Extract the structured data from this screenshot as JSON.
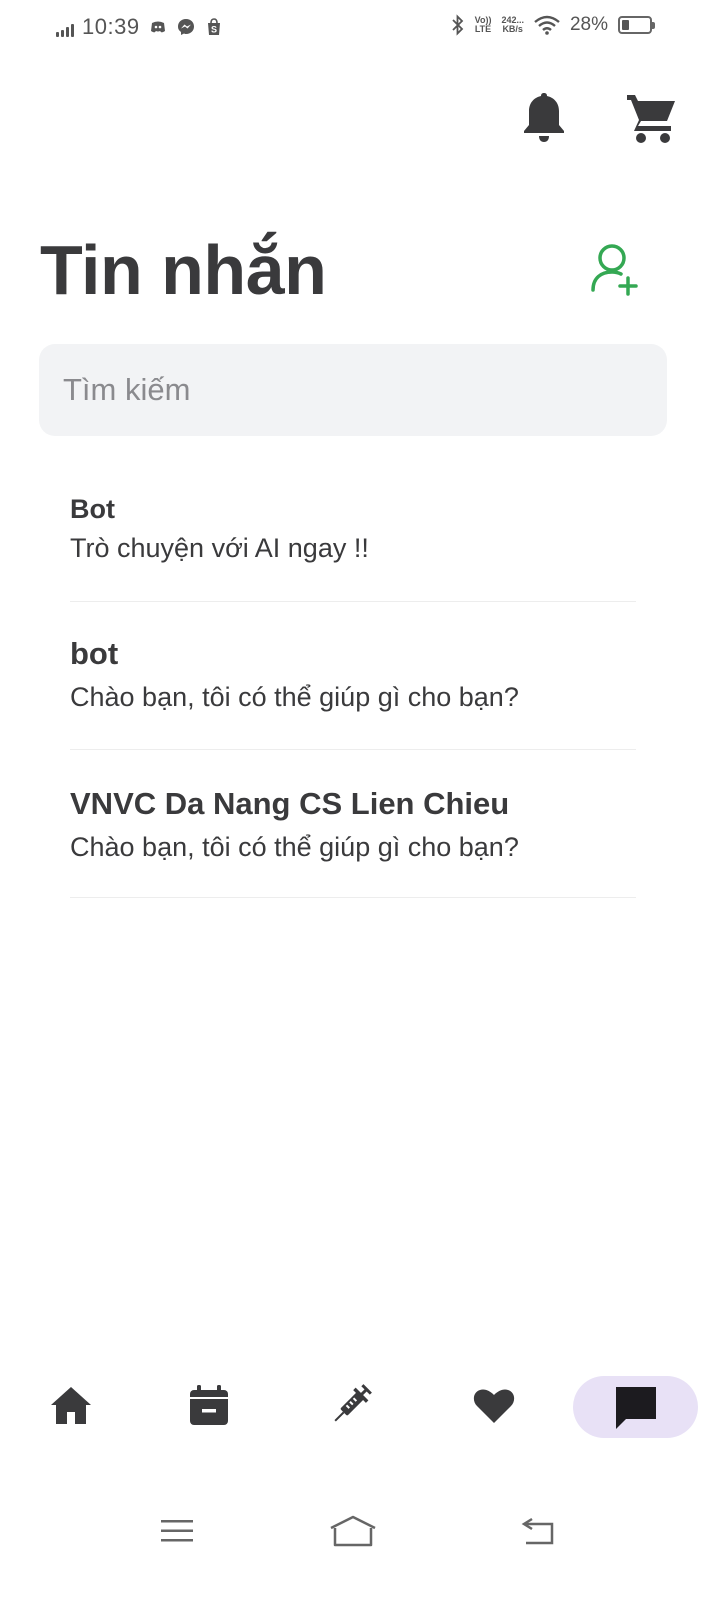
{
  "status_bar": {
    "time": "10:39",
    "network_top": "242...",
    "network_bottom": "KB/s",
    "volte_top": "Vo))",
    "volte_bottom": "LTE",
    "battery_text": "28%",
    "battery_level": 0.28
  },
  "header": {
    "title": "Tin nhắn",
    "accent_color": "#34a853"
  },
  "search": {
    "placeholder": "Tìm kiếm",
    "value": ""
  },
  "conversations": [
    {
      "name": "Bot",
      "message": "Trò chuyện với AI ngay !!"
    },
    {
      "name": "bot",
      "message": "Chào bạn, tôi có thể giúp gì cho bạn?"
    },
    {
      "name": "VNVC Da Nang CS Lien Chieu",
      "message": "Chào bạn, tôi có thể giúp gì cho bạn?"
    }
  ],
  "bottom_nav": {
    "items": [
      "home-icon",
      "calendar-icon",
      "syringe-icon",
      "heart-icon",
      "chat-icon"
    ],
    "active": "chat-icon",
    "active_bg": "#e8e1f6"
  },
  "icons": {
    "notification": "bell-icon",
    "cart": "cart-icon",
    "add_friend": "add-user-icon"
  }
}
